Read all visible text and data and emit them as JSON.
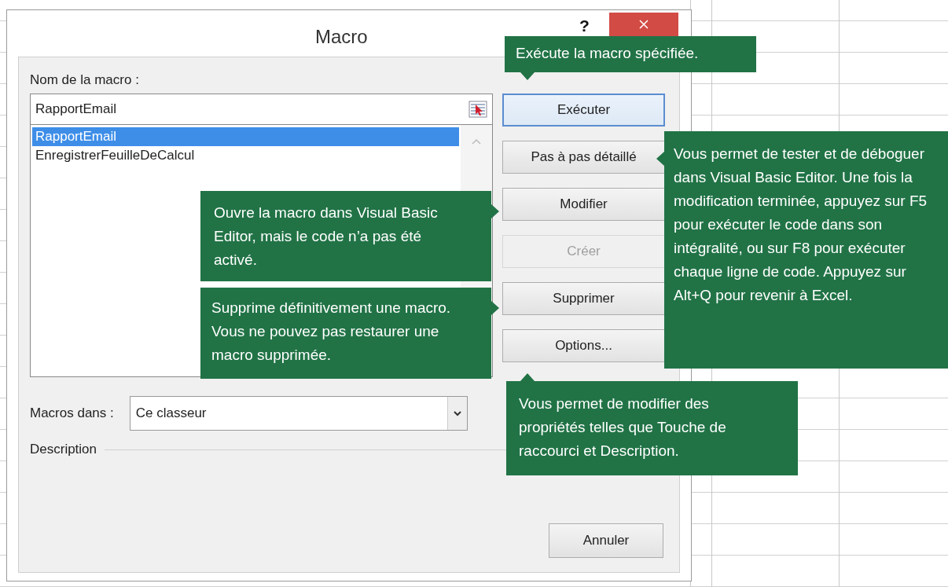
{
  "dialog": {
    "title": "Macro",
    "help": "?",
    "name_label": "Nom de la macro :",
    "name_value": "RapportEmail",
    "macros": [
      {
        "name": "RapportEmail",
        "selected": true
      },
      {
        "name": "EnregistrerFeuilleDeCalcul",
        "selected": false
      }
    ],
    "buttons": [
      {
        "label": "Exécuter",
        "default": true,
        "disabled": false
      },
      {
        "label": "Pas à pas détaillé",
        "default": false,
        "disabled": false
      },
      {
        "label": "Modifier",
        "default": false,
        "disabled": false
      },
      {
        "label": "Créer",
        "default": false,
        "disabled": true
      },
      {
        "label": "Supprimer",
        "default": false,
        "disabled": false
      },
      {
        "label": "Options...",
        "default": false,
        "disabled": false
      }
    ],
    "macros_in_label": "Macros dans :",
    "macros_in_value": "Ce classeur",
    "description_label": "Description",
    "cancel": "Annuler"
  },
  "callouts": [
    {
      "text": "Exécute la macro spécifiée.",
      "kind": "down"
    },
    {
      "text": "Vous permet de tester et de déboguer dans Visual Basic Editor. Une fois la modification terminée, appuyez sur F5 pour exécuter le code dans son intégralité, ou sur F8 pour exécuter chaque ligne de code. Appuyez sur Alt+Q pour revenir à Excel.",
      "kind": "left"
    },
    {
      "text": "Ouvre la macro dans Visual Basic Editor, mais le code n’a pas été activé.",
      "kind": "right"
    },
    {
      "text": "Supprime définitivement une macro. Vous ne pouvez pas restaurer une macro supprimée.",
      "kind": "right"
    },
    {
      "text": "Vous permet de modifier des propriétés telles que Touche de raccourci et Description.",
      "kind": "up"
    }
  ]
}
